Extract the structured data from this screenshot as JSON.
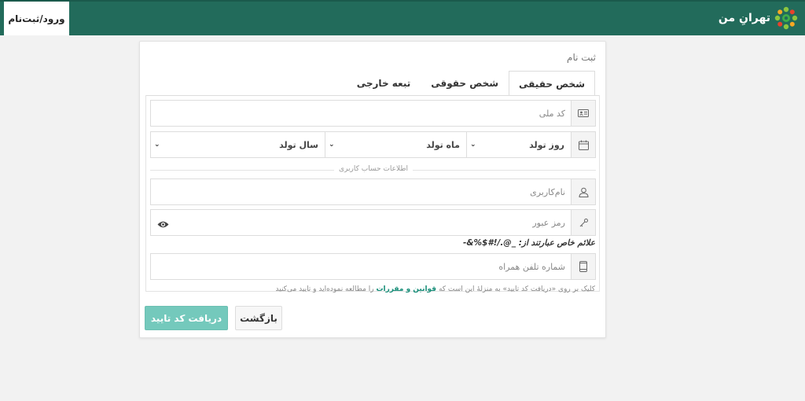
{
  "header": {
    "login_label": "ورود/ثبت‌نام",
    "brand_name": "تهرانِ من",
    "colors": {
      "bar": "#226b5b",
      "accent": "#74c9bc"
    }
  },
  "card": {
    "title": "ثبت نام",
    "tabs": [
      {
        "label": "شخص حقیقی",
        "active": true
      },
      {
        "label": "شخص حقوقی",
        "active": false
      },
      {
        "label": "تبعه خارجی",
        "active": false
      }
    ]
  },
  "form": {
    "national_code": {
      "placeholder": "کد ملی",
      "value": "",
      "icon": "id-card-icon"
    },
    "birth": {
      "icon": "calendar-icon",
      "day": "روز تولد",
      "month": "ماه تولد",
      "year": "سال تولد"
    },
    "section_label": "اطلاعات حساب کاربری",
    "username": {
      "placeholder": "نام‌کاربری",
      "value": "",
      "icon": "user-icon"
    },
    "password": {
      "placeholder": "رمز عبور",
      "value": "",
      "icon": "key-icon",
      "toggle_icon": "eye-icon"
    },
    "special_chars_note": "علائم خاص عبارتند از: _@./!#$%&-",
    "phone": {
      "placeholder": "شماره تلفن همراه",
      "value": "",
      "icon": "mobile-icon"
    },
    "terms": {
      "before": "کلیک بر روی «دریافت کد تایید» به منزلهٔ این است که ",
      "link": "قوانین و مقررات",
      "after": " را مطالعه نموده‌اید و تایید می‌کنید"
    }
  },
  "buttons": {
    "submit": "دریافت کد تایید",
    "back": "بازگشت"
  }
}
